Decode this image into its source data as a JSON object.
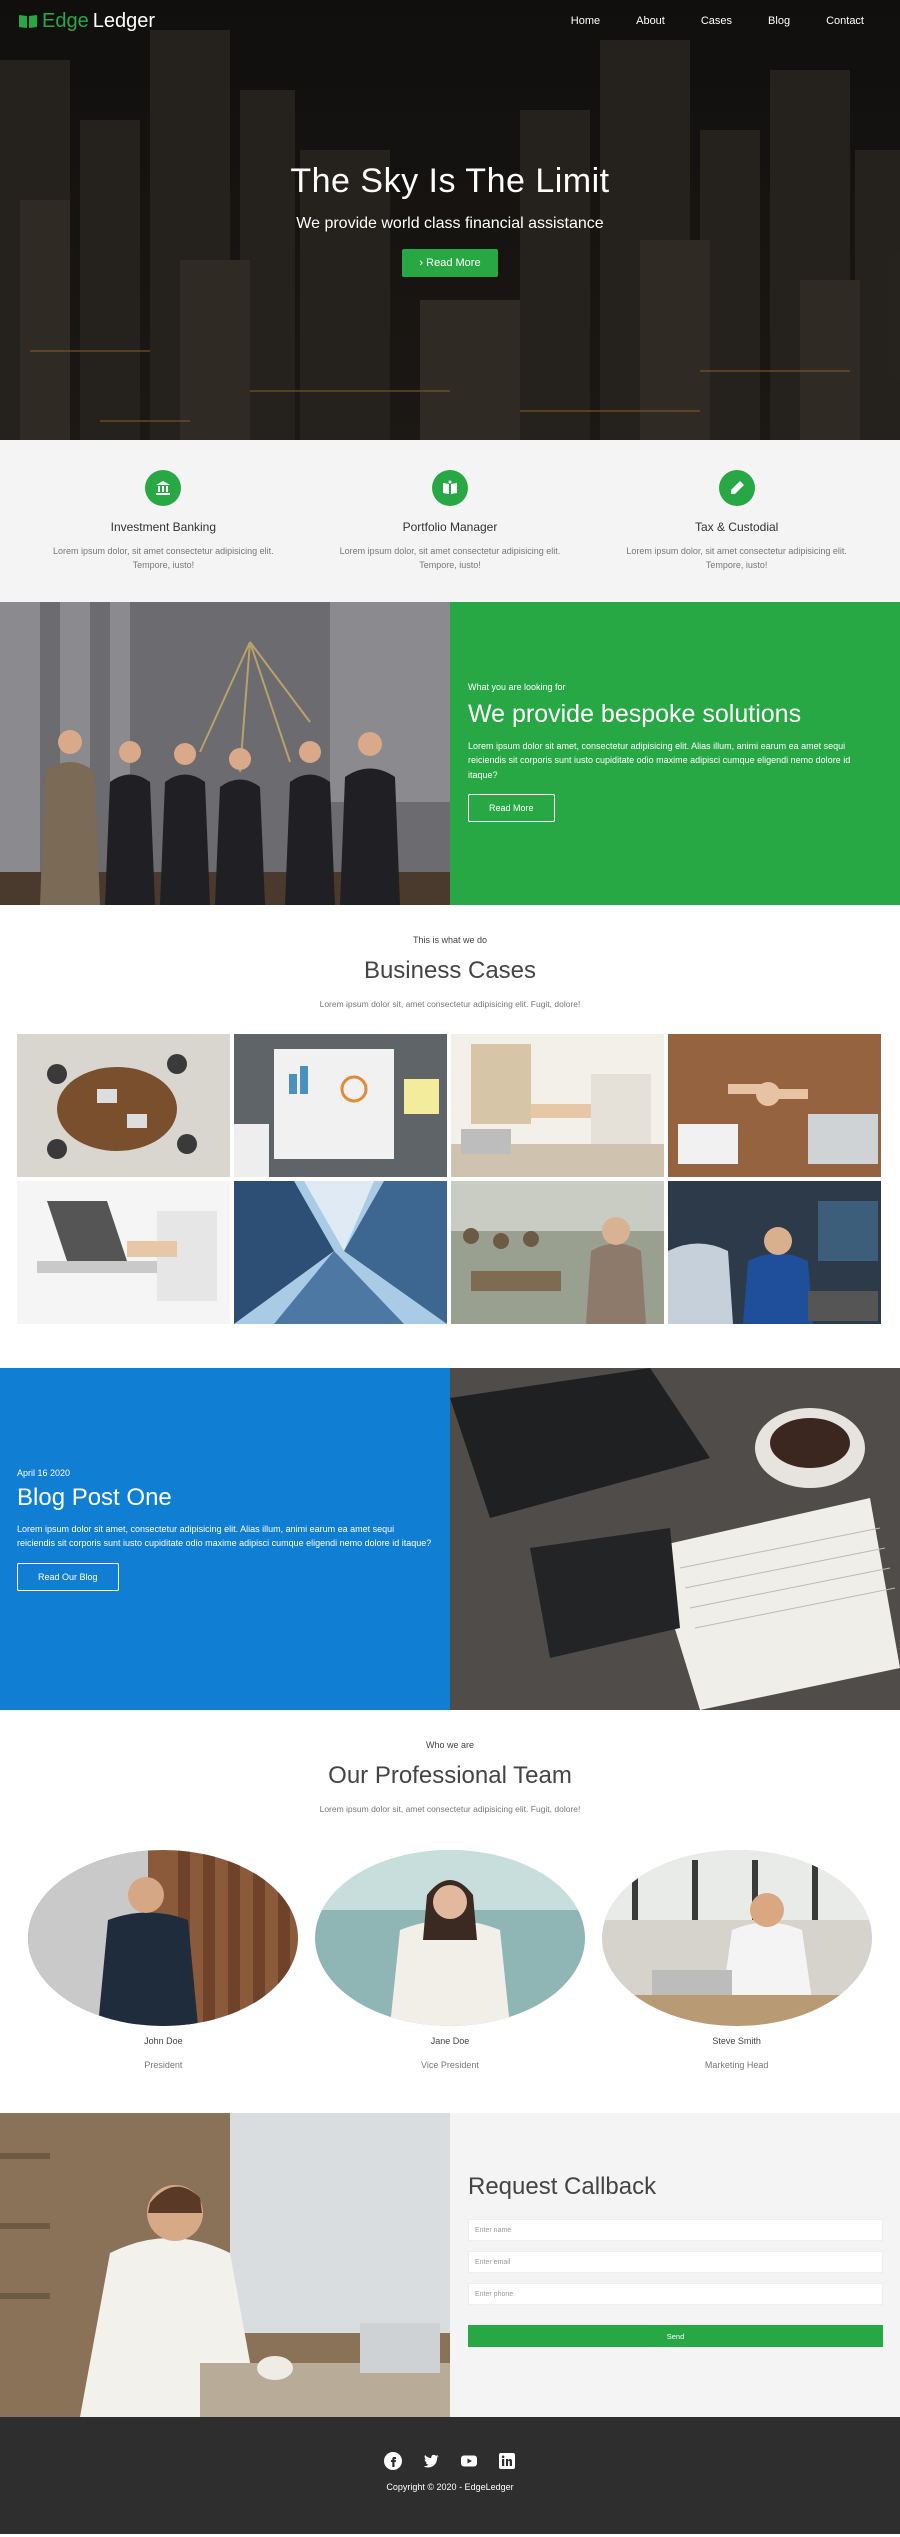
{
  "colors": {
    "brand_green": "#28a745",
    "blog_blue": "#0f7ed3",
    "footer_bg": "#2e2e2e",
    "light_bg": "#f4f4f4"
  },
  "nav": {
    "brand_prefix": "Edge",
    "brand_suffix": "Ledger",
    "items": [
      {
        "label": "Home"
      },
      {
        "label": "About"
      },
      {
        "label": "Cases"
      },
      {
        "label": "Blog"
      },
      {
        "label": "Contact"
      }
    ]
  },
  "hero": {
    "title": "The Sky Is The Limit",
    "subtitle": "We provide world class financial assistance",
    "button_label": "Read More",
    "button_icon": "chevron-right-icon"
  },
  "services": [
    {
      "icon": "bank-icon",
      "title": "Investment Banking",
      "text": "Lorem ipsum dolor, sit amet consectetur adipisicing elit. Tempore, iusto!"
    },
    {
      "icon": "book-icon",
      "title": "Portfolio Manager",
      "text": "Lorem ipsum dolor, sit amet consectetur adipisicing elit. Tempore, iusto!"
    },
    {
      "icon": "pencil-icon",
      "title": "Tax & Custodial",
      "text": "Lorem ipsum dolor, sit amet consectetur adipisicing elit. Tempore, iusto!"
    }
  ],
  "about": {
    "eyebrow": "What you are looking for",
    "title": "We provide bespoke solutions",
    "text": "Lorem ipsum dolor sit amet, consectetur adipisicing elit. Alias illum, animi earum ea amet sequi reiciendis sit corporis sunt iusto cupiditate odio maxime adipisci cumque eligendi nemo dolore id itaque?",
    "button_label": "Read More"
  },
  "cases": {
    "eyebrow": "This is what we do",
    "title": "Business Cases",
    "text": "Lorem ipsum dolor sit, amet consectetur adipisicing elit. Fugit, dolore!"
  },
  "blog": {
    "date": "April 16 2020",
    "title": "Blog Post One",
    "text": "Lorem ipsum dolor sit amet, consectetur adipisicing elit. Alias illum, animi earum ea amet sequi reiciendis sit corporis sunt iusto cupiditate odio maxime adipisci cumque eligendi nemo dolore id itaque?",
    "button_label": "Read Our Blog"
  },
  "team": {
    "eyebrow": "Who we are",
    "title": "Our Professional Team",
    "text": "Lorem ipsum dolor sit, amet consectetur adipisicing elit. Fugit, dolore!",
    "members": [
      {
        "name": "John Doe",
        "role": "President"
      },
      {
        "name": "Jane Doe",
        "role": "Vice President"
      },
      {
        "name": "Steve Smith",
        "role": "Marketing Head"
      }
    ]
  },
  "callback": {
    "title": "Request Callback",
    "name_placeholder": "Enter name",
    "email_placeholder": "Enter email",
    "phone_placeholder": "Enter phone",
    "button_label": "Send"
  },
  "footer": {
    "socials": [
      "facebook-icon",
      "twitter-icon",
      "youtube-icon",
      "linkedin-icon"
    ],
    "copyright": "Copyright © 2020 - EdgeLedger"
  }
}
